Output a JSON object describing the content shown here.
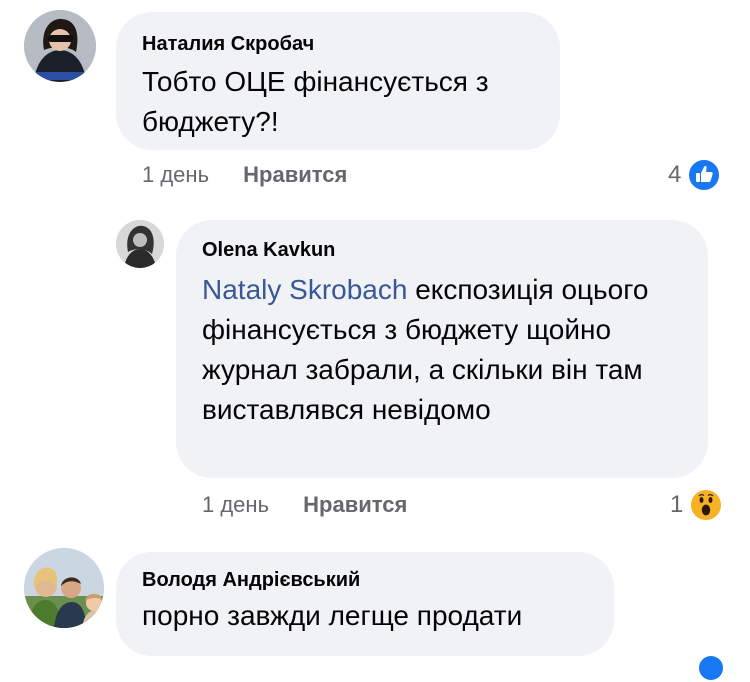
{
  "comments": [
    {
      "author": "Наталия Скробач",
      "text": "Тобто ОЦЕ фінансується з бюджету?!",
      "time": "1 день",
      "like_label": "Нравится",
      "reaction_count": "4",
      "reaction_icon": "thumbs-up-icon"
    },
    {
      "author": "Olena Kavkun",
      "mention": "Nataly Skrobach",
      "text": " експозиція оцього фінансується з бюджету щойно журнал забрали, а скільки він там виставлявся невідомо",
      "time": "1 день",
      "like_label": "Нравится",
      "reaction_count": "1",
      "reaction_icon": "wow-icon"
    },
    {
      "author": "Володя Андрієвський",
      "text": "порно завжди легще продати"
    }
  ],
  "colors": {
    "bubble": "#f0f2f5",
    "link": "#385898",
    "like_blue": "#1877f2",
    "wow_yellow": "#f7b125",
    "meta_gray": "#65676b"
  }
}
